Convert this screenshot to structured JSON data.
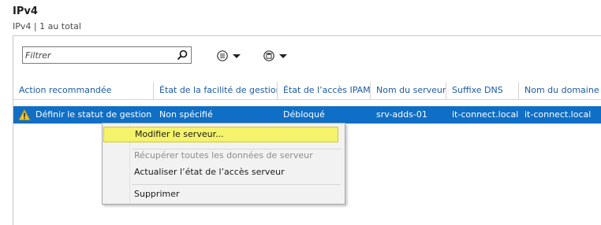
{
  "header": {
    "title": "IPv4",
    "subtitle": "IPv4 | 1 au total"
  },
  "toolbar": {
    "filter_placeholder": "Filtrer",
    "search_icon": "search-icon",
    "tasks_icon": "list-options-icon",
    "save_icon": "save-icon"
  },
  "table": {
    "columns": [
      "Action recommandée",
      "État de la facilité de gestion",
      "État de l’accès IPAM",
      "Nom du serveur",
      "Suffixe DNS",
      "Nom du domaine"
    ],
    "rows": [
      {
        "action": "Définir le statut de gestion",
        "manageability": "Non spécifié",
        "ipam_access": "Débloqué",
        "server_name": "srv-adds-01",
        "dns_suffix": "it-connect.local",
        "domain_name": "it-connect.local",
        "selected": true,
        "icon": "warning-icon"
      }
    ]
  },
  "context_menu": {
    "items": [
      {
        "label": "Modifier le serveur...",
        "enabled": true,
        "highlighted": true
      },
      {
        "label": "Récupérer toutes les données de serveur",
        "enabled": false
      },
      {
        "label": "Actualiser l’état de l’accès serveur",
        "enabled": true
      },
      {
        "label": "Supprimer",
        "enabled": true
      }
    ]
  },
  "colors": {
    "selection": "#0f6fc6",
    "header_text": "#1a5aa8",
    "highlight": "#f4f36a"
  }
}
